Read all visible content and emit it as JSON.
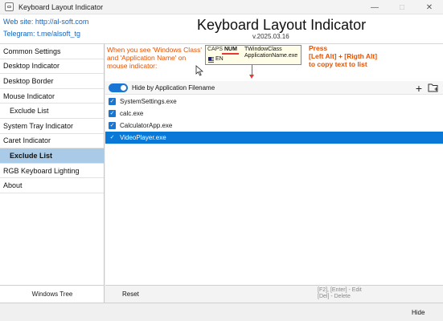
{
  "window": {
    "title": "Keyboard Layout Indicator"
  },
  "header": {
    "website": "Web site: http://al-soft.com",
    "telegram": "Telegram: t.me/alsoft_tg",
    "app_title": "Keyboard Layout Indicator",
    "version": "v.2025.03.16"
  },
  "sidebar": {
    "items": [
      {
        "label": "Common Settings"
      },
      {
        "label": "Desktop Indicator"
      },
      {
        "label": "Desktop Border"
      },
      {
        "label": "Mouse Indicator"
      },
      {
        "label": "Exclude List"
      },
      {
        "label": "System Tray Indicator"
      },
      {
        "label": "Caret Indicator"
      },
      {
        "label": "Exclude List"
      },
      {
        "label": "RGB Keyboard Lighting"
      },
      {
        "label": "About"
      }
    ],
    "footer_button": "Windows Tree"
  },
  "info": {
    "note_line1": "When you see 'Windows Class'",
    "note_line2": "and 'Application Name' on",
    "note_line3": "mouse indicator:",
    "demo_caps": "CAPS",
    "demo_num": "NUM",
    "demo_lang": "EN",
    "demo_class": "TWindowClass",
    "demo_app": "ApplicationName.exe",
    "press_title": "Press",
    "press_keys": "[Left Alt] + [Rigth Alt]",
    "press_action": "to copy text to list"
  },
  "list": {
    "toggle_label": "Hide by Application Filename",
    "toggle_on": true,
    "items": [
      {
        "label": "SystemSettings.exe",
        "checked": true
      },
      {
        "label": "calc.exe",
        "checked": true
      },
      {
        "label": "CalculatorApp.exe",
        "checked": true
      },
      {
        "label": "VideoPlayer.exe",
        "checked": true
      }
    ],
    "selected_index": 3,
    "reset_label": "Reset",
    "hint_line1": "[F2], [Enter] - Edit",
    "hint_line2": "[Del] - Delete"
  },
  "footer": {
    "hide_label": "Hide"
  },
  "colors": {
    "accent": "#1976d2",
    "selection": "#0a78d7",
    "nav_active": "#a9cbe8",
    "note": "#e65100",
    "link": "#1565c0"
  }
}
